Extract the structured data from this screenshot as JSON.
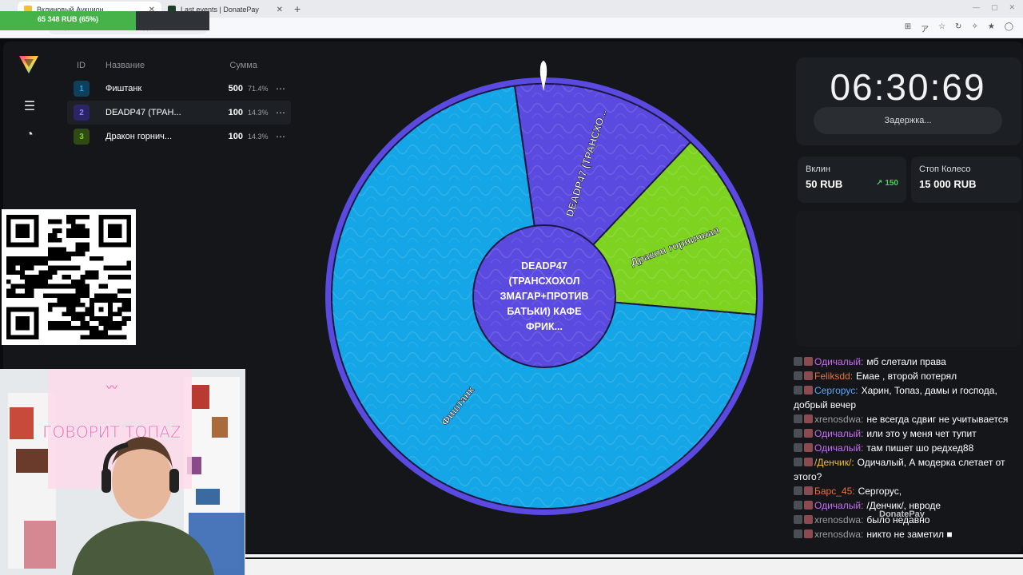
{
  "browser": {
    "tabs": [
      {
        "title": "Вклиновый Аукцион",
        "active": true
      },
      {
        "title": "Last events | DonatePay",
        "active": false
      }
    ],
    "new_tab_label": "+",
    "address": "https://stream-auction.vercel.app/wheel"
  },
  "donatepay_bar": {
    "text": "65 348 RUB (65%)",
    "progress_percent": 65
  },
  "list": {
    "headers": {
      "id": "ID",
      "name": "Название",
      "sum": "Сумма"
    },
    "rows": [
      {
        "id": "1",
        "name": "Фиштанк",
        "sum": "500",
        "pct": "71.4%",
        "color": "#14a6e6"
      },
      {
        "id": "2",
        "name": "DEADP47 (ТРАН...",
        "sum": "100",
        "pct": "14.3%",
        "color": "#5b4ae0"
      },
      {
        "id": "3",
        "name": "Дракон горнич...",
        "sum": "100",
        "pct": "14.3%",
        "color": "#7ed321"
      }
    ],
    "menu_glyph": "⋯"
  },
  "wheel": {
    "center_label": "DEADP47 (ТРАНСХОХОЛ ЗМАГАР+ПРОТИВ БАТЬКИ) КАФЕ ФРИК...",
    "segments": [
      {
        "label": "Фиштанк",
        "fraction": 0.714,
        "color": "#14a6e6"
      },
      {
        "label": "DEADP47 (ТРАНСХО...",
        "fraction": 0.143,
        "color": "#5b4ae0"
      },
      {
        "label": "Дракон горничная",
        "fraction": 0.143,
        "color": "#7ed321"
      }
    ],
    "rim_color": "#5b4ae0"
  },
  "timer": {
    "value": "06:30:69",
    "delay_button": "Задержка..."
  },
  "stats": {
    "entry": {
      "label": "Вклин",
      "value": "50 RUB",
      "delta": "150"
    },
    "stop": {
      "label": "Стоп Колесо",
      "value": "15 000 RUB"
    }
  },
  "chat": [
    {
      "nick": "Одичалый",
      "text": "мб слетали права",
      "color": "#c86cf0"
    },
    {
      "nick": "Feliksdd",
      "text": "Емае , второй потерял",
      "color": "#e8743b"
    },
    {
      "nick": "Сергорус",
      "text": "Харин, Топаз, дамы и господа, добрый вечер",
      "color": "#5aa6ff"
    },
    {
      "nick": "xrenosdwa",
      "text": "не всегда сдвиг не учитывается",
      "color": "#9b9ea3"
    },
    {
      "nick": "Одичалый",
      "text": "или это у меня чет тупит",
      "color": "#c86cf0"
    },
    {
      "nick": "Одичалый",
      "text": "там пишет шо редхед88",
      "color": "#c86cf0"
    },
    {
      "nick": "/Денчик/",
      "text": "Одичалый, А модерка слетает от этого?",
      "color": "#f0c030"
    },
    {
      "nick": "Барс_45",
      "text": "Сергорус,",
      "color": "#e8743b"
    },
    {
      "nick": "Одичалый",
      "text": "/Денчик/, нвроде",
      "color": "#c86cf0"
    },
    {
      "nick": "xrenosdwa",
      "text": "было недавно",
      "color": "#9b9ea3"
    },
    {
      "nick": "xrenosdwa",
      "text": "никто не заметил ■",
      "color": "#9b9ea3"
    }
  ],
  "watermark": "DonatePay",
  "webcam": {
    "neon_text": "ГОВОРИТ ТОПАZ"
  },
  "icons": [
    "logo-icon",
    "list-icon",
    "pie-chart-icon",
    "qr-code-icon",
    "pointer-icon"
  ]
}
